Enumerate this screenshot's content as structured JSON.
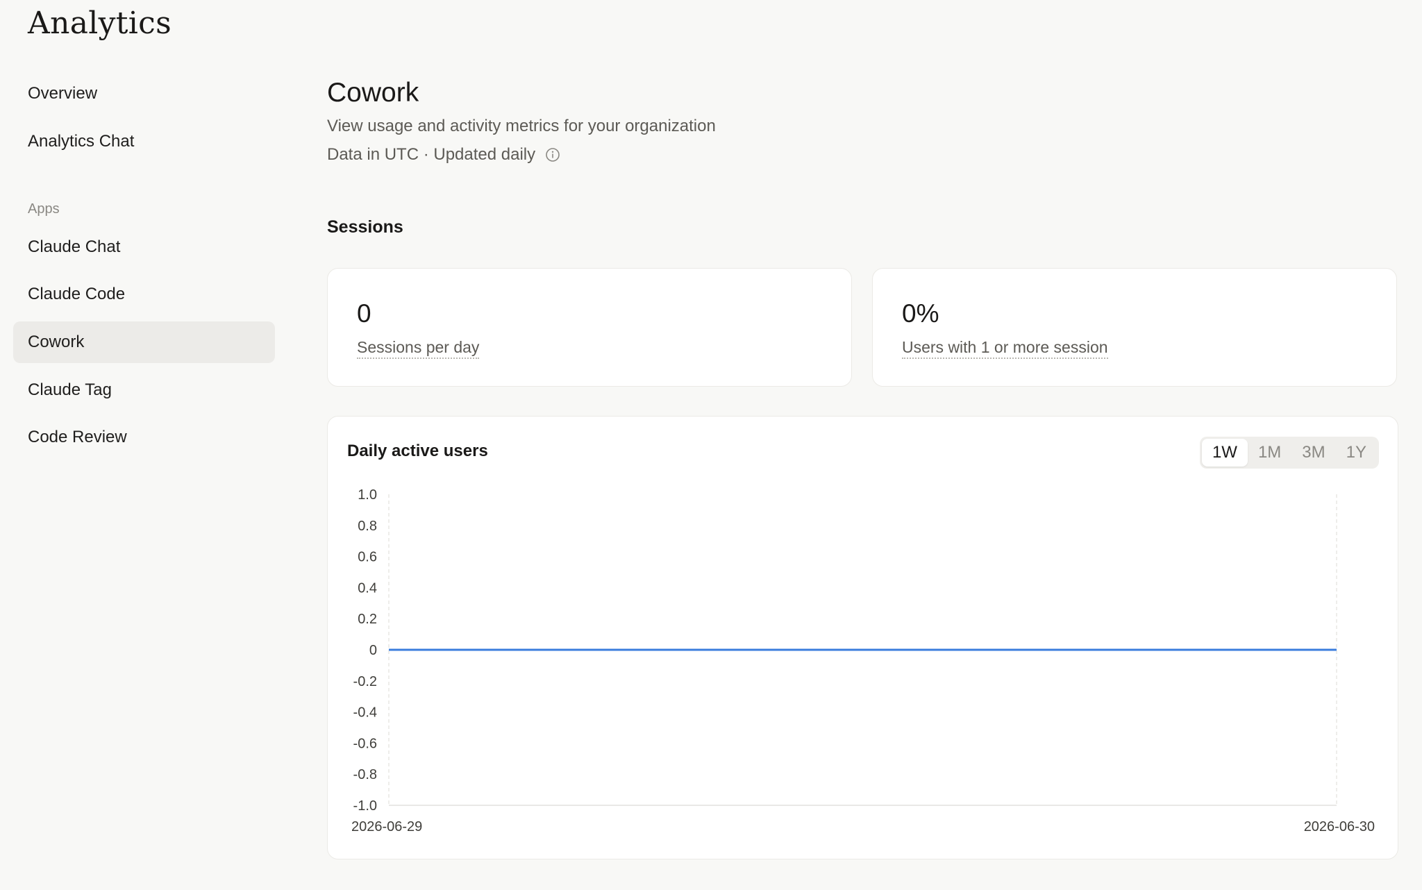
{
  "app": {
    "title": "Analytics"
  },
  "sidebar": {
    "items_top": [
      {
        "label": "Overview"
      },
      {
        "label": "Analytics Chat"
      }
    ],
    "section_label": "Apps",
    "apps": [
      {
        "label": "Claude Chat"
      },
      {
        "label": "Claude Code"
      },
      {
        "label": "Cowork",
        "active": true
      },
      {
        "label": "Claude Tag"
      },
      {
        "label": "Code Review"
      }
    ]
  },
  "page": {
    "title": "Cowork",
    "subtitle": "View usage and activity metrics for your organization",
    "meta": "Data in UTC · Updated daily",
    "section": "Sessions"
  },
  "stats": [
    {
      "value": "0",
      "label": "Sessions per day"
    },
    {
      "value": "0%",
      "label": "Users with 1 or more session"
    }
  ],
  "chart": {
    "title": "Daily active users",
    "ranges": [
      "1W",
      "1M",
      "3M",
      "1Y"
    ],
    "active_range": "1W"
  },
  "chart_data": {
    "type": "line",
    "title": "Daily active users",
    "xlabel": "",
    "ylabel": "",
    "x": [
      "2026-06-29",
      "2026-06-30"
    ],
    "series": [
      {
        "values": [
          0,
          0
        ],
        "color": "#3b7ddd"
      }
    ],
    "ylim": [
      -1.0,
      1.0
    ],
    "yticks": [
      "1.0",
      "0.8",
      "0.6",
      "0.4",
      "0.2",
      "0",
      "-0.2",
      "-0.4",
      "-0.6",
      "-0.8",
      "-1.0"
    ],
    "xticks": [
      "2026-06-29",
      "2026-06-30"
    ],
    "grid": false
  },
  "colors": {
    "accent_line": "#3b7ddd",
    "background": "#f8f8f6",
    "active_nav": "#ecebe8"
  },
  "icons": {
    "info": "info-circle-icon"
  }
}
